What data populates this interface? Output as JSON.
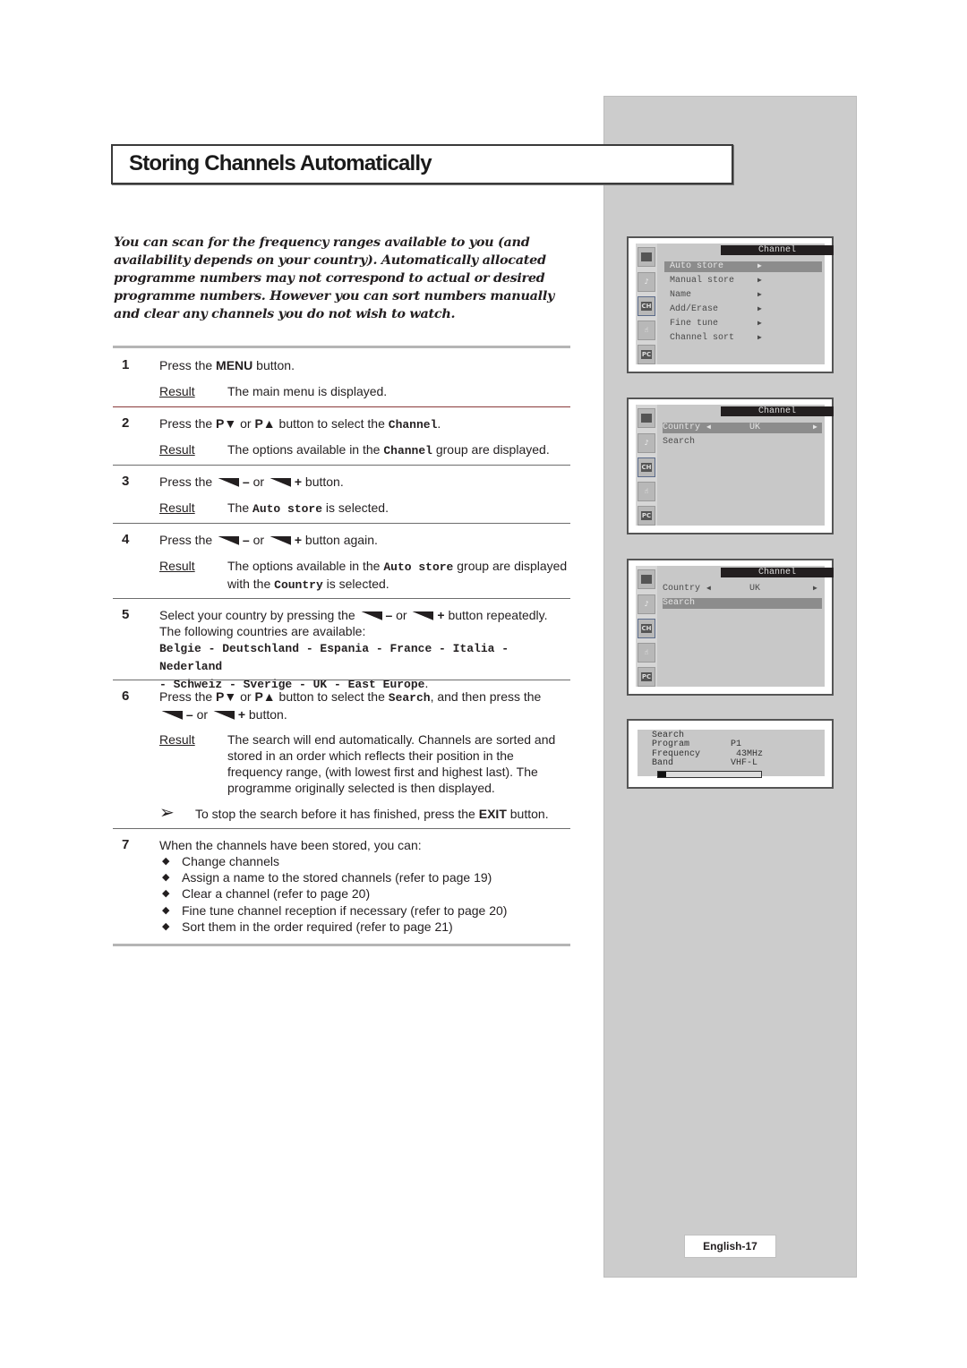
{
  "page": {
    "title": "Storing Channels Automatically",
    "intro": "You can scan for the frequency ranges available to you (and availability depends on your country). Automatically allocated programme numbers may not correspond to actual or desired programme numbers. However you can sort numbers manually and clear any channels you do not wish to watch.",
    "page_number": "English-17"
  },
  "labels": {
    "result": "Result",
    "colon": ":",
    "press_the": "Press the ",
    "or": " or ",
    "minus": "–",
    "plus": "+",
    "p_down": "P▼",
    "p_up": "P▲"
  },
  "steps": [
    {
      "num": "1",
      "text_a": "Press the ",
      "bold": "MENU",
      "text_b": " button.",
      "result": "The main menu is displayed."
    },
    {
      "num": "2",
      "text_a": " button to select the ",
      "mono": "Channel",
      "text_b": ".",
      "result_a": "The options available in the ",
      "result_mono": "Channel",
      "result_b": " group are displayed."
    },
    {
      "num": "3",
      "text_b": " button.",
      "result_a": "The ",
      "result_mono": "Auto store",
      "result_b": " is selected."
    },
    {
      "num": "4",
      "text_b": " button again.",
      "result_a": "The options available in the ",
      "result_mono": "Auto store",
      "result_b": " group are displayed with the ",
      "result_mono2": "Country",
      "result_c": " is selected."
    },
    {
      "num": "5",
      "text_a": "Select your country by pressing the ",
      "text_b": " button repeatedly.",
      "text_c": "The following countries are available:",
      "countries": "Belgie - Deutschland - Espania - France - Italia - Nederland",
      "countries2": "- Schweiz - Sverige - UK - East Europe",
      "countries_end": "."
    },
    {
      "num": "6",
      "text_a": " button to select the ",
      "mono": "Search",
      "text_b": ", and then press the",
      "text_c": " button.",
      "result": "The search will end automatically. Channels are sorted and stored in an order which reflects their position in the frequency range, (with lowest first and highest last). The programme originally selected is then displayed.",
      "note_a": "To stop the search before it has finished, press the ",
      "note_bold": "EXIT",
      "note_b": " button."
    },
    {
      "num": "7",
      "text": "When the channels have been stored, you can:",
      "bullets": [
        "Change channels",
        "Assign a name to the stored channels (refer to page 19)",
        "Clear a channel (refer to page 20)",
        "Fine tune channel reception if necessary (refer to page 20)",
        "Sort them in the order required (refer to page 21)"
      ]
    }
  ],
  "screens": {
    "menu_title": "Channel",
    "screen1": {
      "items": [
        {
          "label": "Auto store",
          "arrow": "▶",
          "highlighted": true
        },
        {
          "label": "Manual store",
          "arrow": "▶",
          "highlighted": false
        },
        {
          "label": "Name",
          "arrow": "▶",
          "highlighted": false
        },
        {
          "label": "Add/Erase",
          "arrow": "▶",
          "highlighted": false
        },
        {
          "label": "Fine tune",
          "arrow": "▶",
          "highlighted": false
        },
        {
          "label": "Channel sort",
          "arrow": "▶",
          "highlighted": false
        }
      ]
    },
    "screen2": {
      "country_label": "Country",
      "left_arrow": "◀",
      "country_value": "UK",
      "right_arrow": "▶",
      "search_label": "Search",
      "highlighted": "Country"
    },
    "screen3": {
      "country_label": "Country",
      "left_arrow": "◀",
      "country_value": "UK",
      "right_arrow": "▶",
      "search_label": "Search",
      "highlighted": "Search"
    },
    "icons": [
      "picture-icon",
      "sound-icon",
      "channel-icon",
      "function-icon",
      "pc-icon"
    ],
    "icon_labels": {
      "ch": "CH",
      "pc": "PC"
    },
    "search_status": {
      "title": "Search",
      "rows": [
        {
          "label": "Program",
          "value": "P1"
        },
        {
          "label": "Frequency",
          "value": " 43MHz"
        },
        {
          "label": "Band",
          "value": "VHF-L"
        }
      ],
      "progress_percent": 8
    }
  }
}
